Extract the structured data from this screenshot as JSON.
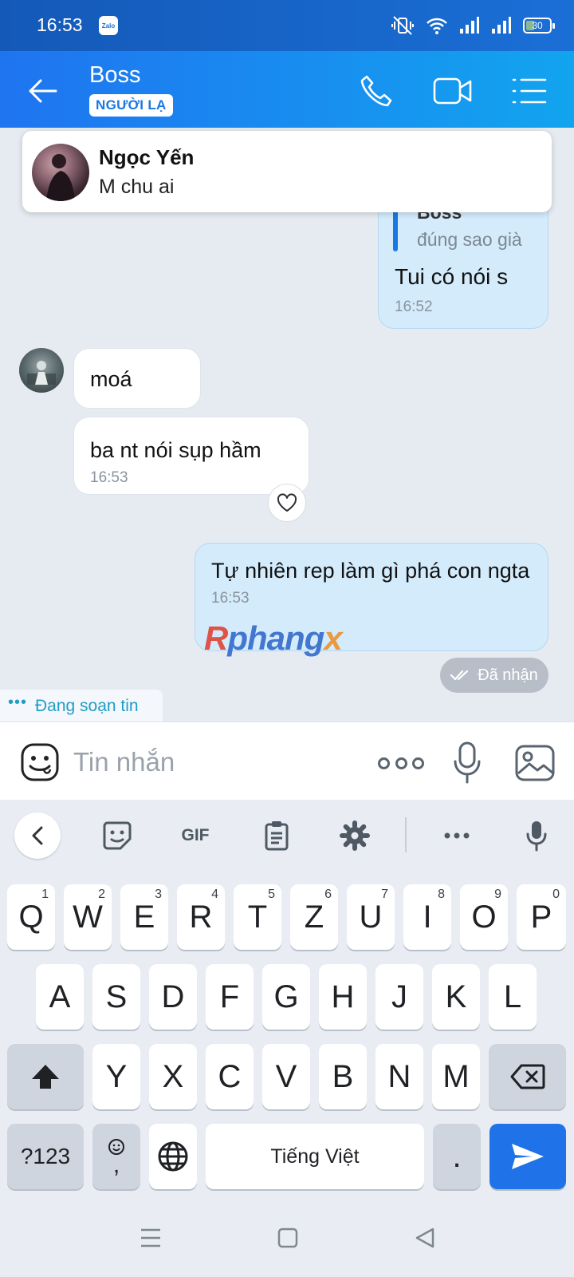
{
  "status_bar": {
    "time": "16:53",
    "app_badge": "Zalo",
    "battery": "30"
  },
  "header": {
    "contact_name": "Boss",
    "badge": "NGƯỜI LẠ"
  },
  "notification": {
    "sender": "Ngọc Yến",
    "message": "M chu ai"
  },
  "messages": {
    "quoted": {
      "author": "Boss",
      "quote": "đúng sao già",
      "reply": "Tui có nói s",
      "time": "16:52"
    },
    "incoming": [
      {
        "text": "moá"
      },
      {
        "text": "ba nt nói sụp hầm",
        "time": "16:53"
      }
    ],
    "outgoing": {
      "text": "Tự nhiên rep làm gì phá con ngta",
      "time": "16:53"
    },
    "status": "Đã nhận",
    "typing": "Đang soạn tin"
  },
  "watermark": {
    "part1": "R",
    "part2": "phang",
    "part3": "x"
  },
  "composer": {
    "placeholder": "Tin nhắn"
  },
  "keyboard": {
    "gif_label": "GIF",
    "row1": [
      {
        "k": "Q",
        "n": "1"
      },
      {
        "k": "W",
        "n": "2"
      },
      {
        "k": "E",
        "n": "3"
      },
      {
        "k": "R",
        "n": "4"
      },
      {
        "k": "T",
        "n": "5"
      },
      {
        "k": "Z",
        "n": "6"
      },
      {
        "k": "U",
        "n": "7"
      },
      {
        "k": "I",
        "n": "8"
      },
      {
        "k": "O",
        "n": "9"
      },
      {
        "k": "P",
        "n": "0"
      }
    ],
    "row2": [
      "A",
      "S",
      "D",
      "F",
      "G",
      "H",
      "J",
      "K",
      "L"
    ],
    "row3": [
      "Y",
      "X",
      "C",
      "V",
      "B",
      "N",
      "M"
    ],
    "symbols_label": "?123",
    "comma_label": ",",
    "space_label": "Tiếng Việt",
    "period_label": "."
  },
  "colors": {
    "header_start": "#1f74f0",
    "header_end": "#12a4ef",
    "my_bubble": "#d3ebfb",
    "send_key": "#1f72e8"
  }
}
